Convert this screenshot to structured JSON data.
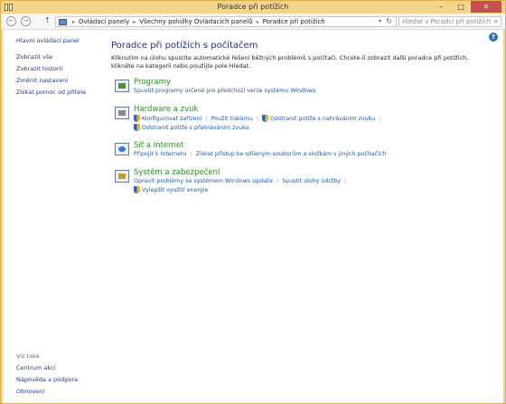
{
  "window": {
    "title": "Poradce při potížích"
  },
  "controls": {
    "minimize": "–",
    "maximize": "□",
    "close": "✕"
  },
  "address": {
    "back": "←",
    "forward": "→",
    "up": "↑",
    "crumbs": [
      "Ovládací panely",
      "Všechny položky Ovládacích panelů",
      "Poradce při potížích"
    ],
    "search_placeholder": "Hledat v Poradci při potížích"
  },
  "sidebar": {
    "home": "Hlavní ovládací panel",
    "items": [
      "Zobrazit vše",
      "Zobrazit historii",
      "Změnit nastavení",
      "Získat pomoc od přítele"
    ]
  },
  "see_also": {
    "title": "Viz také",
    "items": [
      "Centrum akcí",
      "Nápověda a podpora",
      "Obnovení"
    ]
  },
  "main": {
    "title": "Poradce při potížích s počítačem",
    "intro": "Kliknutím na úlohu spustíte automatické řešení běžných problémů s počítači. Chcete-li zobrazit další poradce při potížích, klikněte na kategorii nebo použijte pole Hledat."
  },
  "categories": [
    {
      "title": "Programy",
      "tasks": [
        {
          "label": "Spustit programy určené pro předchozí verze systému Windows",
          "shield": false
        }
      ]
    },
    {
      "title": "Hardware a zvuk",
      "tasks": [
        {
          "label": "Konfigurovat zařízení",
          "shield": true
        },
        {
          "label": "Použít tiskárnu",
          "shield": false
        },
        {
          "label": "Odstranit potíže s nahráváním zvuku",
          "shield": true
        },
        {
          "label": "Odstranit potíže s přehráváním zvuku",
          "shield": true
        }
      ]
    },
    {
      "title": "Síť a Internet",
      "tasks": [
        {
          "label": "Připojit k Internetu",
          "shield": false
        },
        {
          "label": "Získat přístup ke sdíleným souborům a složkám v jiných počítačích",
          "shield": false
        }
      ]
    },
    {
      "title": "Systém a zabezpečení",
      "tasks": [
        {
          "label": "Opravit problémy se systémem Windows Update",
          "shield": false
        },
        {
          "label": "Spustit úlohy údržby",
          "shield": false
        },
        {
          "label": "Vylepšit využití energie",
          "shield": true
        }
      ]
    }
  ]
}
